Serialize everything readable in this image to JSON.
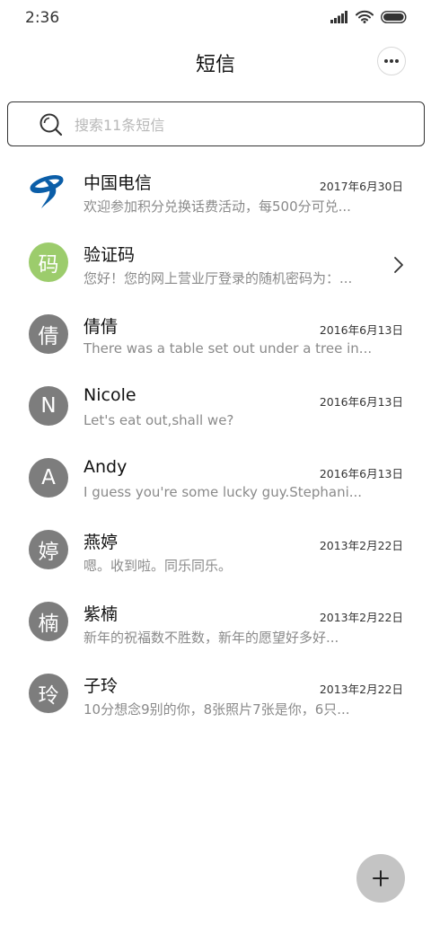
{
  "status_bar": {
    "time": "2:36",
    "icons": [
      "signal-icon",
      "wifi-icon",
      "battery-icon"
    ]
  },
  "header": {
    "title": "短信",
    "more_icon": "more-dots-icon"
  },
  "search": {
    "placeholder": "搜索11条短信",
    "icon": "search-icon"
  },
  "messages": [
    {
      "avatar": "",
      "avatar_type": "logo",
      "name": "中国电信",
      "preview": "欢迎参加积分兑换话费活动，每500分可兑...",
      "date": "2017年6月30日"
    },
    {
      "avatar": "码",
      "avatar_type": "green",
      "name": "验证码",
      "preview": "您好！您的网上营业厅登录的随机密码为：...",
      "date": "",
      "chevron": true
    },
    {
      "avatar": "倩",
      "avatar_type": "gray",
      "name": "倩倩",
      "preview": "There was a table set out under a tree in...",
      "date": "2016年6月13日"
    },
    {
      "avatar": "N",
      "avatar_type": "gray",
      "name": "Nicole",
      "preview": "Let's eat out,shall we?",
      "date": "2016年6月13日"
    },
    {
      "avatar": "A",
      "avatar_type": "gray",
      "name": "Andy",
      "preview": "I guess you're some lucky guy.Stephani...",
      "date": "2016年6月13日"
    },
    {
      "avatar": "婷",
      "avatar_type": "gray",
      "name": "燕婷",
      "preview": "嗯。收到啦。同乐同乐。",
      "date": "2013年2月22日"
    },
    {
      "avatar": "楠",
      "avatar_type": "gray",
      "name": "紫楠",
      "preview": "新年的祝福数不胜数，新年的愿望好多好...",
      "date": "2013年2月22日"
    },
    {
      "avatar": "玲",
      "avatar_type": "gray",
      "name": "子玲",
      "preview": "10分想念9别的你，8张照片7张是你，6只...",
      "date": "2013年2月22日"
    }
  ],
  "fab": {
    "icon": "plus-icon"
  },
  "colors": {
    "avatar_gray": "#7d7d7d",
    "avatar_green": "#9ccc6c",
    "fab": "#c4c4c4",
    "telecom_blue": "#0b5ea8"
  }
}
